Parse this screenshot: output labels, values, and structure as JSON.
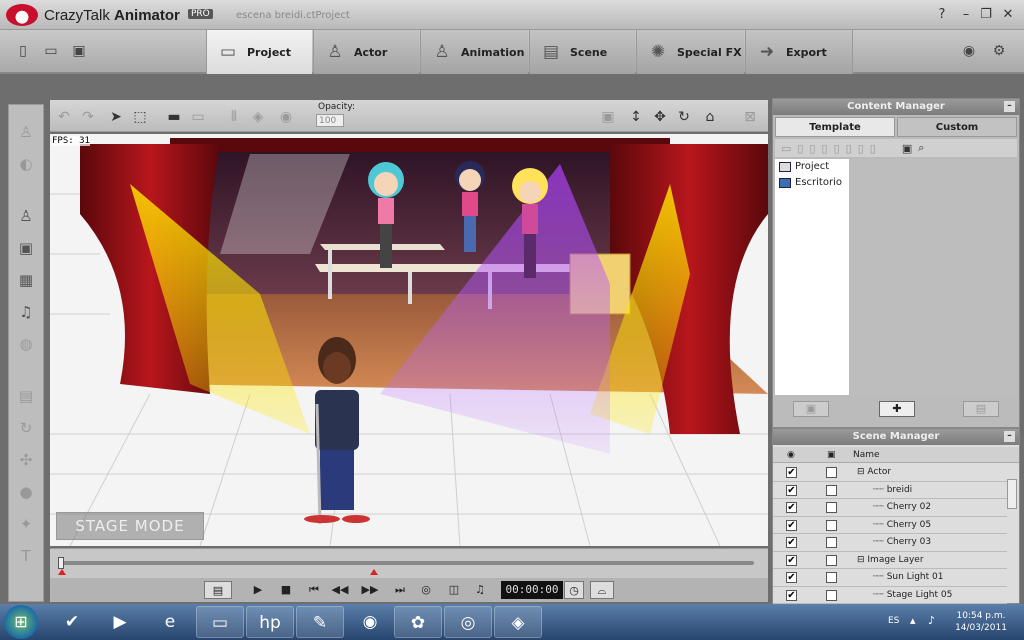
{
  "app": {
    "name_light": "CrazyTalk",
    "name_bold": "Animator",
    "badge": "PRO",
    "document_title": "escena breidi.ctProject"
  },
  "window_buttons": {
    "help": "?",
    "minimize": "–",
    "restore": "❐",
    "close": "✕"
  },
  "tabs": [
    {
      "label": "Project",
      "icon": "folder-icon",
      "active": true
    },
    {
      "label": "Actor",
      "icon": "actor-icon",
      "active": false
    },
    {
      "label": "Animation",
      "icon": "animation-icon",
      "active": false
    },
    {
      "label": "Scene",
      "icon": "scene-icon",
      "active": false
    },
    {
      "label": "Special FX",
      "icon": "fx-icon",
      "active": false
    },
    {
      "label": "Export",
      "icon": "export-icon",
      "active": false
    }
  ],
  "viewport": {
    "opacity_label": "Opacity:",
    "opacity_value": "100",
    "fps_text": "FPS:  31",
    "stage_mode_label": "STAGE MODE"
  },
  "playback": {
    "timecode": "00:00:00"
  },
  "content_manager": {
    "title": "Content Manager",
    "subtabs": [
      "Template",
      "Custom"
    ],
    "tree": [
      "Project",
      "Escritorio"
    ]
  },
  "scene_manager": {
    "title": "Scene Manager",
    "name_header": "Name",
    "rows": [
      {
        "name": "Actor",
        "visible": true,
        "locked": false,
        "group": true
      },
      {
        "name": "breidi",
        "visible": true,
        "locked": false,
        "group": false
      },
      {
        "name": "Cherry 02",
        "visible": true,
        "locked": false,
        "group": false
      },
      {
        "name": "Cherry 05",
        "visible": true,
        "locked": false,
        "group": false
      },
      {
        "name": "Cherry 03",
        "visible": true,
        "locked": false,
        "group": false
      },
      {
        "name": "Image Layer",
        "visible": true,
        "locked": false,
        "group": true
      },
      {
        "name": "Sun Light 01",
        "visible": true,
        "locked": false,
        "group": false
      },
      {
        "name": "Stage Light 05",
        "visible": true,
        "locked": false,
        "group": false
      }
    ]
  },
  "taskbar": {
    "lang": "ES",
    "time": "10:54 p.m.",
    "date": "14/03/2011"
  },
  "colors": {
    "curtain": "#8f1116",
    "floor": "#c87a46",
    "accent": "#c8102e"
  }
}
